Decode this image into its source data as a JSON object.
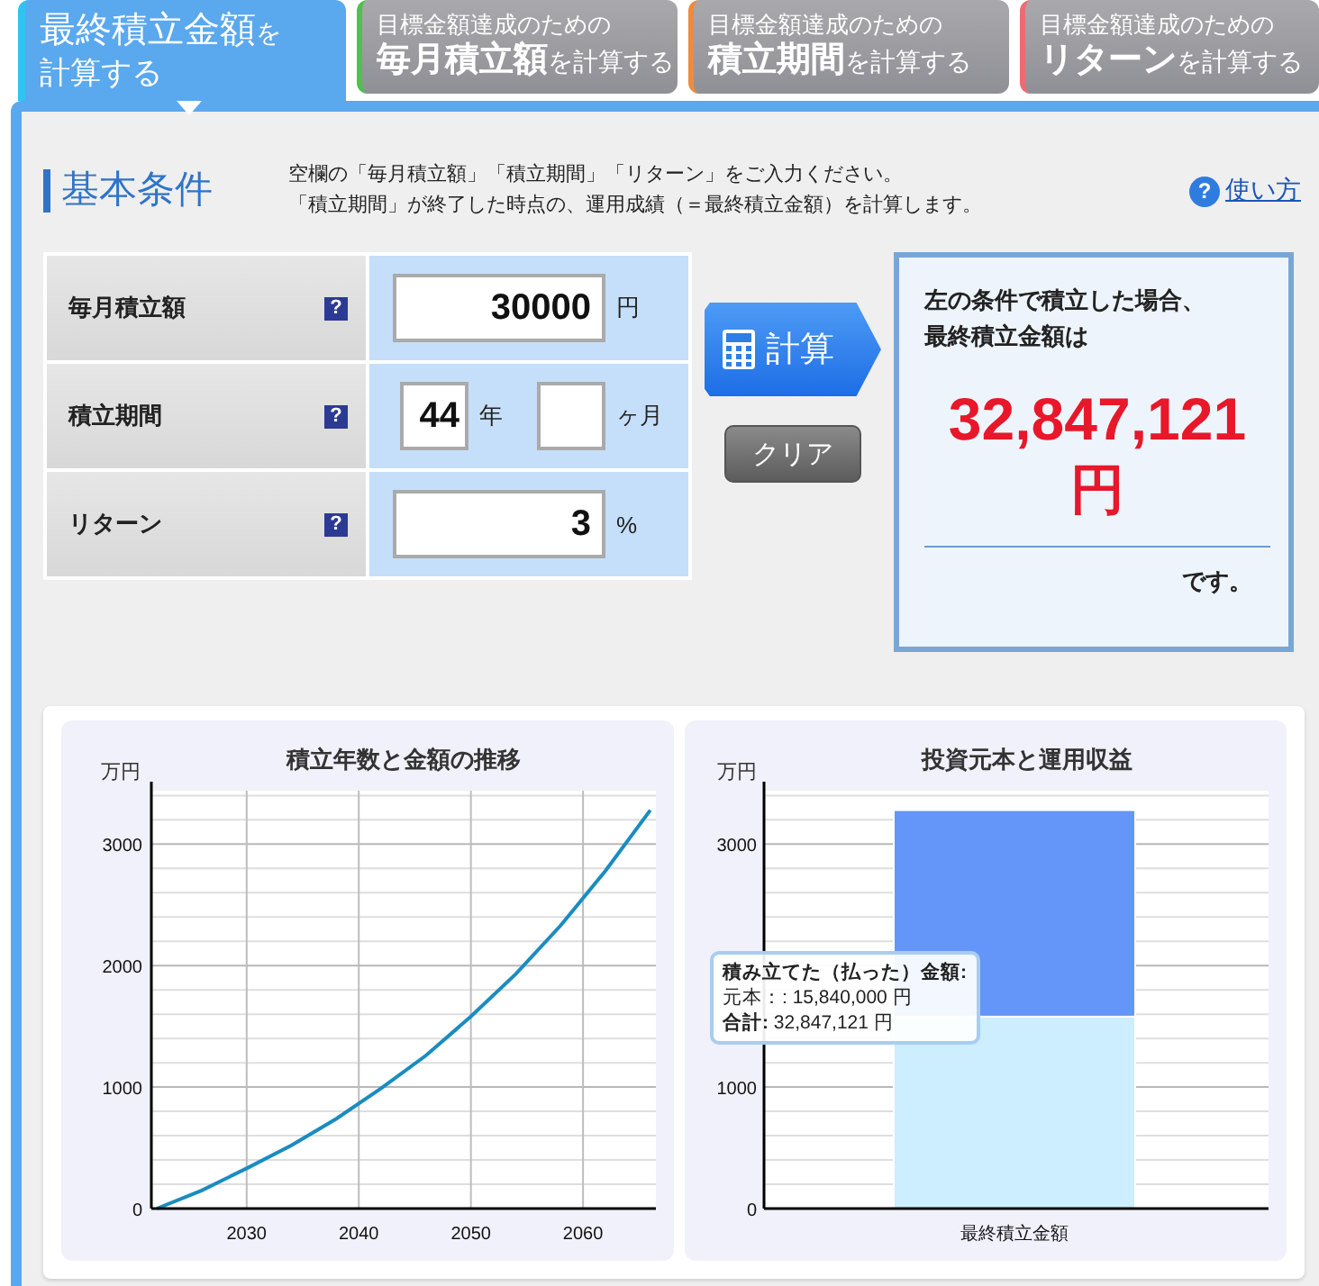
{
  "tabs": [
    {
      "main": "最終積立金額",
      "suffix": "を",
      "line2": "計算する",
      "color": "#2ec4f0",
      "selected": true
    },
    {
      "caption": "目標金額達成のための",
      "main": "毎月積立額",
      "suffix": "を計算する",
      "color": "#4cc34a",
      "selected": false
    },
    {
      "caption": "目標金額達成のための",
      "main": "積立期間",
      "suffix": "を計算する",
      "color": "#f08a3c",
      "selected": false
    },
    {
      "caption": "目標金額達成のための",
      "main": "リターン",
      "suffix": "を計算する",
      "color": "#ee6b72",
      "selected": false
    }
  ],
  "section": {
    "title": "基本条件",
    "description": [
      "空欄の「毎月積立額」「積立期間」「リターン」をご入力ください。",
      "「積立期間」が終了した時点の、運用成績（＝最終積立金額）を計算します。"
    ],
    "help_mark": "?",
    "help_link": "使い方"
  },
  "form": [
    {
      "kind": "single",
      "label": "毎月積立額",
      "help": "?",
      "value": "30000",
      "unit": "円"
    },
    {
      "kind": "period",
      "label": "積立期間",
      "help": "?",
      "years": "44",
      "years_unit": "年",
      "months_unit": "ヶ月"
    },
    {
      "kind": "single",
      "label": "リターン",
      "help": "?",
      "value": "3",
      "unit": "%"
    }
  ],
  "calculate_button": "計算",
  "clear_button": "クリア",
  "result": {
    "lines": [
      "左の条件で積立した場合、",
      "最終積立金額は"
    ],
    "amount": "32,847,121",
    "currency": "円",
    "suffix": "です。"
  },
  "charts": [
    {
      "chart_data": {
        "type": "line",
        "title": "積立年数と金額の推移",
        "ylabel": "万円",
        "x": [
          2022,
          2026,
          2030,
          2034,
          2038,
          2042,
          2046,
          2050,
          2054,
          2058,
          2062,
          2066
        ],
        "values": [
          0,
          150,
          330,
          520,
          740,
          990,
          1260,
          1580,
          1930,
          2330,
          2780,
          3280
        ],
        "color": "#1a8cc0",
        "grid": true,
        "xlim": [
          2021.5,
          2066.5
        ],
        "ylim": [
          0,
          3440
        ],
        "xticks": [
          2030,
          2040,
          2050,
          2060
        ],
        "yticks": [
          0,
          1000,
          2000,
          3000
        ]
      }
    },
    {
      "chart_data": {
        "type": "bar",
        "stacked": true,
        "title": "投資元本と運用収益",
        "ylabel": "万円",
        "categories": [
          "最終積立金額"
        ],
        "series": [
          {
            "color": "#cceeff",
            "values": [
              1580
            ]
          },
          {
            "color": "#6495f8",
            "values": [
              1700
            ]
          }
        ],
        "grid": true,
        "ylim": [
          0,
          3440
        ],
        "yticks": [
          0,
          1000,
          3000
        ]
      },
      "tooltip": [
        "**積み立てた（払った）金額:**",
        "元本：: 15,840,000 円",
        "**合計:** 32,847,121 円"
      ]
    }
  ]
}
